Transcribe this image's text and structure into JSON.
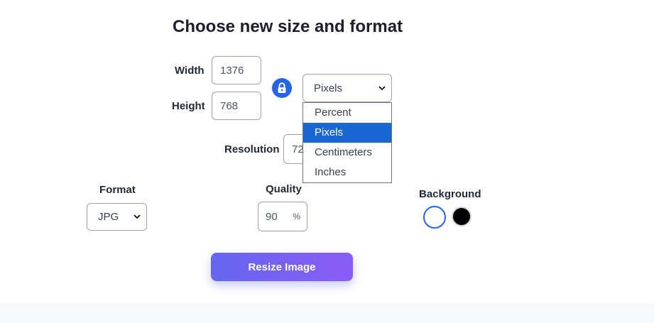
{
  "title": "Choose new size and format",
  "width": {
    "label": "Width",
    "value": "1376"
  },
  "height": {
    "label": "Height",
    "value": "768"
  },
  "unit": {
    "selected": "Pixels",
    "options": [
      "Percent",
      "Pixels",
      "Centimeters",
      "Inches"
    ]
  },
  "resolution": {
    "label": "Resolution",
    "value": "72"
  },
  "format": {
    "label": "Format",
    "selected": "JPG"
  },
  "quality": {
    "label": "Quality",
    "value": "90",
    "unit": "%"
  },
  "background": {
    "label": "Background",
    "colors": [
      "#ffffff",
      "#000000"
    ],
    "selected_index": 0
  },
  "resize_button": "Resize Image",
  "accent": "#2563eb",
  "icons": {
    "lock": "lock-icon",
    "chevron": "chevron-down-icon"
  }
}
